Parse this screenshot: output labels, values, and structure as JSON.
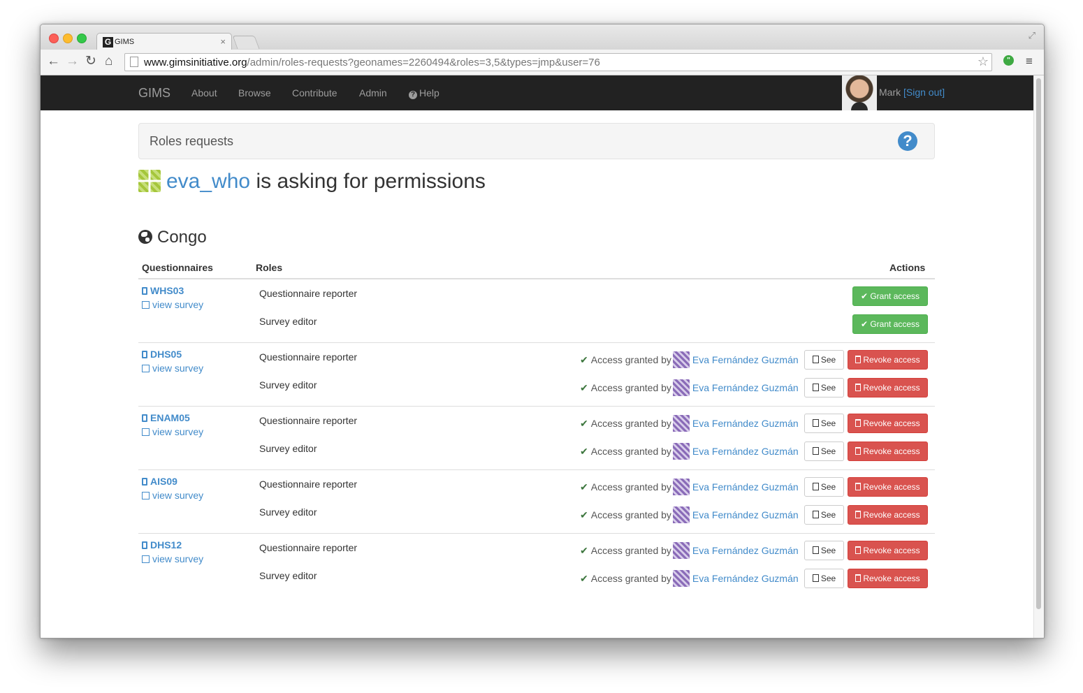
{
  "browser": {
    "tab_title": "GIMS",
    "tab_favicon": "G",
    "tab_close": "×",
    "url_host": "www.gimsinitiative.org",
    "url_path": "/admin/roles-requests?geonames=2260494&roles=3,5&types=jmp&user=76",
    "icons": {
      "back": "←",
      "forward": "→",
      "reload": "↻",
      "home": "⌂",
      "star": "☆",
      "menu": "≡",
      "fullscreen": "⤢",
      "hangouts": "\""
    }
  },
  "navbar": {
    "brand": "GIMS",
    "links": [
      "About",
      "Browse",
      "Contribute",
      "Admin",
      "Help"
    ],
    "help_icon": "?",
    "user": "Mark",
    "signout": "[Sign out]"
  },
  "breadcrumb": {
    "title": "Roles requests",
    "help_icon": "?"
  },
  "heading": {
    "username": "eva_who",
    "text": "is asking for permissions"
  },
  "country": "Congo",
  "table": {
    "headers": {
      "questionnaires": "Questionnaires",
      "roles": "Roles",
      "actions": "Actions"
    },
    "view_survey": "view survey",
    "granted_prefix": "Access granted by",
    "granted_by": "Eva Fernández Guzmán",
    "check_mark": "✔",
    "grant_label": "✔ Grant access",
    "see_label": "See",
    "revoke_label": "Revoke access",
    "role_names": [
      "Questionnaire reporter",
      "Survey editor"
    ],
    "rows": [
      {
        "code": "WHS03",
        "status": "pending"
      },
      {
        "code": "DHS05",
        "status": "granted"
      },
      {
        "code": "ENAM05",
        "status": "granted"
      },
      {
        "code": "AIS09",
        "status": "granted"
      },
      {
        "code": "DHS12",
        "status": "granted"
      }
    ]
  },
  "colors": {
    "link": "#428bca",
    "navbar_bg": "#222222",
    "grant": "#5cb85c",
    "revoke": "#d9534f",
    "success_check": "#3c763d"
  }
}
